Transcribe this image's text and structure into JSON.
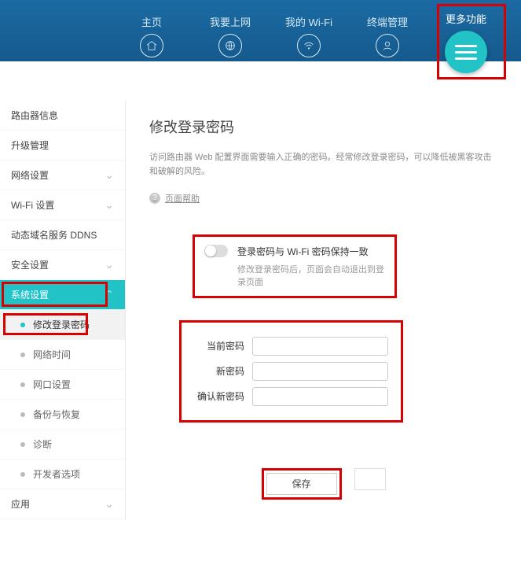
{
  "topnav": {
    "items": [
      {
        "label": "主页",
        "icon": "home-icon"
      },
      {
        "label": "我要上网",
        "icon": "globe-icon"
      },
      {
        "label": "我的 Wi-Fi",
        "icon": "wifi-icon"
      },
      {
        "label": "终端管理",
        "icon": "user-icon"
      },
      {
        "label": "更多功能",
        "icon": "menu-icon"
      }
    ]
  },
  "sidebar": {
    "items": [
      {
        "label": "路由器信息",
        "kind": "plain"
      },
      {
        "label": "升级管理",
        "kind": "plain"
      },
      {
        "label": "网络设置",
        "kind": "expandable"
      },
      {
        "label": "Wi-Fi 设置",
        "kind": "expandable"
      },
      {
        "label": "动态域名服务 DDNS",
        "kind": "plain"
      },
      {
        "label": "安全设置",
        "kind": "expandable"
      },
      {
        "label": "系统设置",
        "kind": "expandable-active"
      },
      {
        "label": "修改登录密码",
        "kind": "sub-selected"
      },
      {
        "label": "网络时间",
        "kind": "sub"
      },
      {
        "label": "网口设置",
        "kind": "sub"
      },
      {
        "label": "备份与恢复",
        "kind": "sub"
      },
      {
        "label": "诊断",
        "kind": "sub"
      },
      {
        "label": "开发者选项",
        "kind": "sub"
      },
      {
        "label": "应用",
        "kind": "expandable"
      }
    ]
  },
  "main": {
    "title": "修改登录密码",
    "desc": "访问路由器 Web 配置界面需要输入正确的密码。经常修改登录密码，可以降低被黑客攻击和破解的风险。",
    "help": "页面帮助",
    "toggle_title": "登录密码与 Wi-Fi 密码保持一致",
    "toggle_sub": "修改登录密码后，页面会自动退出到登录页面",
    "form": {
      "current": "当前密码",
      "new": "新密码",
      "confirm": "确认新密码"
    },
    "save": "保存"
  }
}
